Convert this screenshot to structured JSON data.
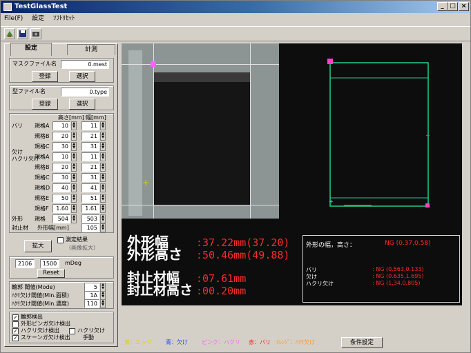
{
  "window": {
    "title": "TestGlassTest"
  },
  "titlebar_buttons": [
    "_",
    "□",
    "×"
  ],
  "menu": [
    "File(F)",
    "設定",
    "ｿﾌﾄﾘｾｯﾄ"
  ],
  "toolbar": {
    "icons": [
      "calibrate-icon",
      "save-icon",
      "camera-icon"
    ]
  },
  "tabs": [
    "設定",
    "計測"
  ],
  "mask_file": {
    "label": "マスクファイル名",
    "value": "0.mest",
    "register": "登録",
    "select": "選択"
  },
  "template_file": {
    "label": "型ファイル名",
    "value": "0.type",
    "register": "登録",
    "select": "選択"
  },
  "table": {
    "col_height": "高さ[mm]",
    "col_width": "幅[mm]",
    "rows": [
      {
        "group": "バリ",
        "name": "規格A",
        "h": "10",
        "w": "11"
      },
      {
        "group": "",
        "name": "規格B",
        "h": "20",
        "w": "21"
      },
      {
        "group": "",
        "name": "規格C",
        "h": "30",
        "w": "31"
      },
      {
        "group": "欠け\nハクリ欠け",
        "name": "規格A",
        "h": "10",
        "w": "11"
      },
      {
        "group": "",
        "name": "規格B",
        "h": "20",
        "w": "21"
      },
      {
        "group": "",
        "name": "規格C",
        "h": "30",
        "w": "31"
      },
      {
        "group": "",
        "name": "規格D",
        "h": "40",
        "w": "41"
      },
      {
        "group": "",
        "name": "規格E",
        "h": "50",
        "w": "51"
      },
      {
        "group": "",
        "name": "規格F",
        "h": "1.60",
        "w": "1.61"
      }
    ],
    "outer_row": {
      "group": "外形",
      "name": "規格",
      "h": "504",
      "w": "503"
    },
    "seal_row": {
      "group": "封止材",
      "name": "外形幅[mm]",
      "w": "105"
    }
  },
  "expand": {
    "button": "拡大",
    "check": "測定結果",
    "sub": "（画像拡大）"
  },
  "params": {
    "a": "2106",
    "b": "1500",
    "unit": "mDeg",
    "reset": "Reset"
  },
  "thresholds": [
    {
      "label": "輪郭 閾値(Mode)",
      "value": "5"
    },
    {
      "label": "ﾊｸﾘ欠け閾値(Min.面積)",
      "value": "1A"
    },
    {
      "label": "ﾊｸﾘ欠け閾値(Min.濃度)",
      "value": "110"
    }
  ],
  "checks": [
    {
      "label": "輪郭検出",
      "checked": true
    },
    {
      "label": "外形ピンガ欠け検出",
      "checked": false
    },
    {
      "label": "ハクリ欠け検出",
      "checked": true
    },
    {
      "label": "ハクリ欠け",
      "checked": false
    },
    {
      "label": "スケーンガ欠け検出",
      "checked": true
    },
    {
      "label": "手動",
      "checked": false
    }
  ],
  "results": {
    "outer_w_label": "外形幅",
    "outer_h_label": "外形高さ",
    "outer_w_value": ":37.22mm(37.20)",
    "outer_h_value": ":50.46mm(49.88)",
    "seal_w_label": "封止材幅",
    "seal_h_label": "封止材高さ",
    "seal_w_value": ":07.61mm",
    "seal_h_value": ":00.20mm"
  },
  "judge": {
    "title": "外形の幅，高さ：",
    "title_value": "NG (0.37,0.58)",
    "rows": [
      {
        "label": "バリ",
        "value": ": NG (0.563,0.133)"
      },
      {
        "label": "欠け",
        "value": ": NG (0.635,1.695)"
      },
      {
        "label": "ハクリ欠け",
        "value": ": NG (1.34,0.805)"
      }
    ]
  },
  "legend": [
    {
      "text": "黄：エッジ",
      "color": "#e0d000"
    },
    {
      "text": "青：欠け",
      "color": "#2040ff"
    },
    {
      "text": "ピンク：ハクリ",
      "color": "#ff60ff"
    },
    {
      "text": "赤：バリ",
      "color": "#ff2020"
    },
    {
      "text": "ｵﾚﾝｼﾞ：ﾊｸﾘ欠け",
      "color": "#ff9020"
    }
  ],
  "cond_button": "条件設定",
  "colors": {
    "outline_green": "#20d090",
    "defect_pink": "#ff40c0",
    "result_text": "#ff2a2a",
    "judge_border": "#d0d0d0"
  }
}
